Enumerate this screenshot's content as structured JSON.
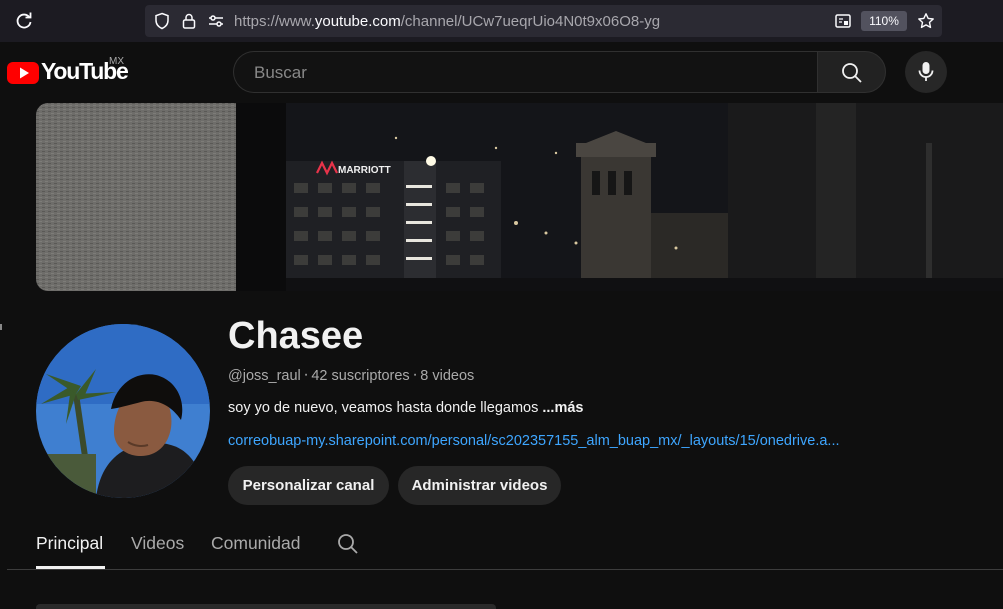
{
  "browser": {
    "url_prefix": "https://www.",
    "url_host": "youtube.com",
    "url_path": "/channel/UCw7ueqrUio4N0t9x06O8-yg",
    "zoom": "110%"
  },
  "masthead": {
    "logo_text": "YouTube",
    "country_code": "MX",
    "search_placeholder": "Buscar"
  },
  "channel": {
    "name": "Chasee",
    "handle": "@joss_raul",
    "subscribers": "42 suscriptores",
    "videos": "8 videos",
    "separator": "‧",
    "description": "soy yo de nuevo, veamos hasta donde llegamos ",
    "more_label": "...más",
    "link": "correobuap-my.sharepoint.com/personal/sc202357155_alm_buap_mx/_layouts/15/onedrive.a...",
    "banner_sign": "MARRIOTT"
  },
  "actions": {
    "customize_label": "Personalizar canal",
    "manage_label": "Administrar videos"
  },
  "tabs": [
    {
      "label": "Principal",
      "active": true
    },
    {
      "label": "Videos",
      "active": false
    },
    {
      "label": "Comunidad",
      "active": false
    }
  ],
  "colors": {
    "background": "#0f0f0f",
    "brand_red": "#ff0000",
    "link_blue": "#3ea6ff"
  },
  "icons": [
    "reload-icon",
    "shield-icon",
    "lock-icon",
    "permissions-icon",
    "reader-view-icon",
    "bookmark-star-icon",
    "youtube-logo-icon",
    "search-icon",
    "mic-icon"
  ]
}
